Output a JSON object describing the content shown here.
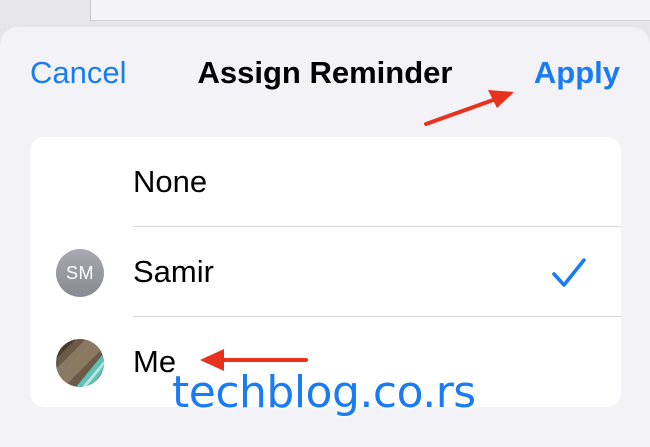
{
  "header": {
    "cancel_label": "Cancel",
    "title": "Assign Reminder",
    "apply_label": "Apply"
  },
  "options": [
    {
      "label": "None",
      "avatar": "none",
      "selected": false
    },
    {
      "label": "Samir",
      "avatar": "initials",
      "initials": "SM",
      "selected": true
    },
    {
      "label": "Me",
      "avatar": "photo",
      "selected": false
    }
  ],
  "watermark": "techblog.co.rs",
  "colors": {
    "accent": "#1a7cf5",
    "annotation_arrow": "#e8321e",
    "sheet_background": "#f2f2f7",
    "list_background": "#ffffff"
  }
}
